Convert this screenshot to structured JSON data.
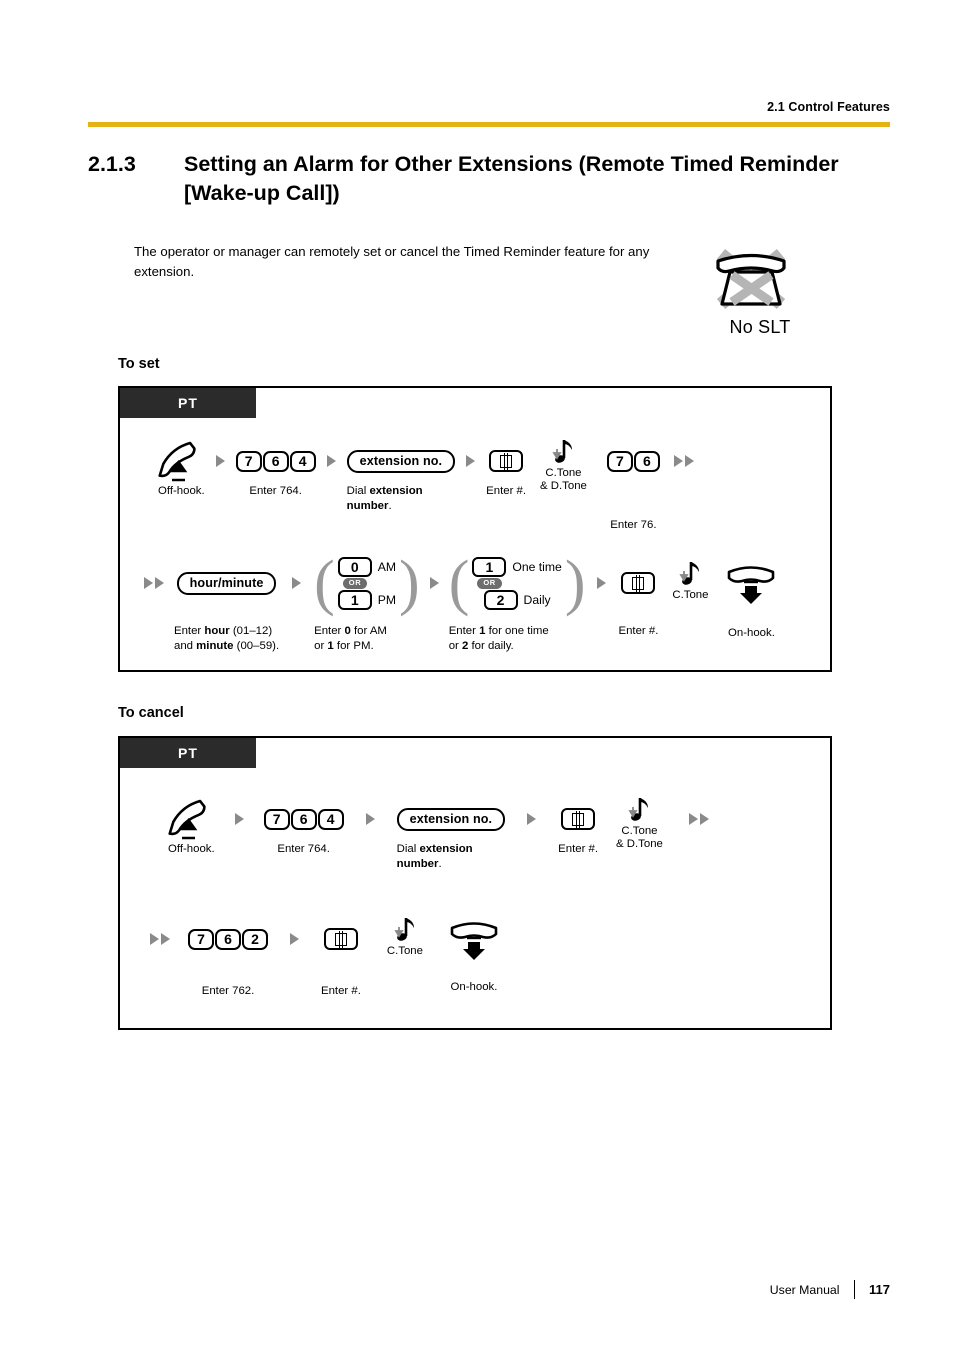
{
  "header": {
    "running_head": "2.1 Control Features",
    "rule_color": "#e5b313"
  },
  "section": {
    "number": "2.1.3",
    "title": "Setting an Alarm for Other Extensions (Remote Timed Reminder [Wake-up Call])"
  },
  "intro": {
    "text": "The operator or manager can remotely set or cancel the Timed Reminder feature for any extension."
  },
  "availability": {
    "icon": "no-slt-telephone-icon",
    "label": "No SLT"
  },
  "procedures": [
    {
      "heading": "To set",
      "phone_type": "PT",
      "rows": [
        {
          "steps": [
            {
              "type": "offhook-icon",
              "caption": "Off-hook."
            },
            {
              "type": "arrow"
            },
            {
              "type": "keys",
              "keys": [
                "7",
                "6",
                "4"
              ],
              "caption": "Enter 764."
            },
            {
              "type": "arrow"
            },
            {
              "type": "wide-key",
              "label": "extension no.",
              "caption": "Dial extension\nnumber."
            },
            {
              "type": "arrow"
            },
            {
              "type": "hash-key",
              "label": "#",
              "caption": "Enter #."
            },
            {
              "type": "tone",
              "label": "C.Tone\n& D.Tone"
            },
            {
              "type": "keys",
              "keys": [
                "7",
                "6"
              ],
              "caption": "Enter 76."
            },
            {
              "type": "arrow-double"
            }
          ]
        },
        {
          "steps": [
            {
              "type": "arrow-double"
            },
            {
              "type": "wide-key",
              "label": "hour/minute",
              "caption": "Enter hour (01–12)\nand minute (00–59)."
            },
            {
              "type": "arrow"
            },
            {
              "type": "option-group",
              "or_label": "OR",
              "options": [
                {
                  "key": "0",
                  "text": "AM"
                },
                {
                  "key": "1",
                  "text": "PM"
                }
              ],
              "caption": "Enter 0 for AM\nor 1 for PM."
            },
            {
              "type": "arrow"
            },
            {
              "type": "option-group",
              "or_label": "OR",
              "options": [
                {
                  "key": "1",
                  "text": "One time"
                },
                {
                  "key": "2",
                  "text": "Daily"
                }
              ],
              "caption": "Enter 1 for one time\nor 2 for daily."
            },
            {
              "type": "arrow"
            },
            {
              "type": "hash-key",
              "label": "#",
              "caption": "Enter #."
            },
            {
              "type": "tone",
              "label": "C.Tone"
            },
            {
              "type": "onhook-icon",
              "caption": "On-hook."
            }
          ]
        }
      ]
    },
    {
      "heading": "To cancel",
      "phone_type": "PT",
      "rows": [
        {
          "steps": [
            {
              "type": "offhook-icon",
              "caption": "Off-hook."
            },
            {
              "type": "arrow"
            },
            {
              "type": "keys",
              "keys": [
                "7",
                "6",
                "4"
              ],
              "caption": "Enter 764."
            },
            {
              "type": "arrow"
            },
            {
              "type": "wide-key",
              "label": "extension no.",
              "caption": "Dial extension\nnumber."
            },
            {
              "type": "arrow"
            },
            {
              "type": "hash-key",
              "label": "#",
              "caption": "Enter #."
            },
            {
              "type": "tone",
              "label": "C.Tone\n& D.Tone"
            },
            {
              "type": "arrow-double"
            }
          ]
        },
        {
          "steps": [
            {
              "type": "arrow-double"
            },
            {
              "type": "keys",
              "keys": [
                "7",
                "6",
                "2"
              ],
              "caption": "Enter 762."
            },
            {
              "type": "arrow"
            },
            {
              "type": "hash-key",
              "label": "#",
              "caption": "Enter #."
            },
            {
              "type": "tone",
              "label": "C.Tone"
            },
            {
              "type": "onhook-icon",
              "caption": "On-hook."
            }
          ]
        }
      ]
    }
  ],
  "labels": {
    "set_heading": "To set",
    "cancel_heading": "To cancel",
    "pt_tag": "PT",
    "offhook_caption_1": "Off-hook.",
    "enter764_caption_1": "Enter 764.",
    "dial_ext_caption_1_a": "Dial ",
    "dial_ext_caption_1_b": "extension",
    "dial_ext_caption_1_c": "number",
    "dial_ext_caption_1_d": ".",
    "enter_hash_caption": "Enter #.",
    "enter76_caption": "Enter 76.",
    "ext_no_key": "extension no.",
    "hour_minute_key": "hour/minute",
    "hour_cap_1": "Enter ",
    "hour_cap_2": "hour",
    "hour_cap_3": " (01–12)",
    "hour_cap_4": "and ",
    "hour_cap_5": "minute",
    "hour_cap_6": " (00–59).",
    "ampm_cap_1": "Enter ",
    "ampm_cap_2": "0",
    "ampm_cap_3": " for AM",
    "ampm_cap_4": "or ",
    "ampm_cap_5": "1",
    "ampm_cap_6": " for PM.",
    "freq_cap_1": "Enter ",
    "freq_cap_2": "1",
    "freq_cap_3": " for one time",
    "freq_cap_4": "or ",
    "freq_cap_5": "2",
    "freq_cap_6": " for daily.",
    "onhook_caption": "On-hook.",
    "enter762_caption": "Enter 762.",
    "ctone": "C.Tone",
    "ctone_dtone_line1": "C.Tone",
    "ctone_dtone_line2": "& D.Tone",
    "am": "AM",
    "pm": "PM",
    "one_time": "One time",
    "daily": "Daily",
    "or": "OR"
  },
  "footer": {
    "manual_label": "User Manual",
    "page_number": "117"
  }
}
